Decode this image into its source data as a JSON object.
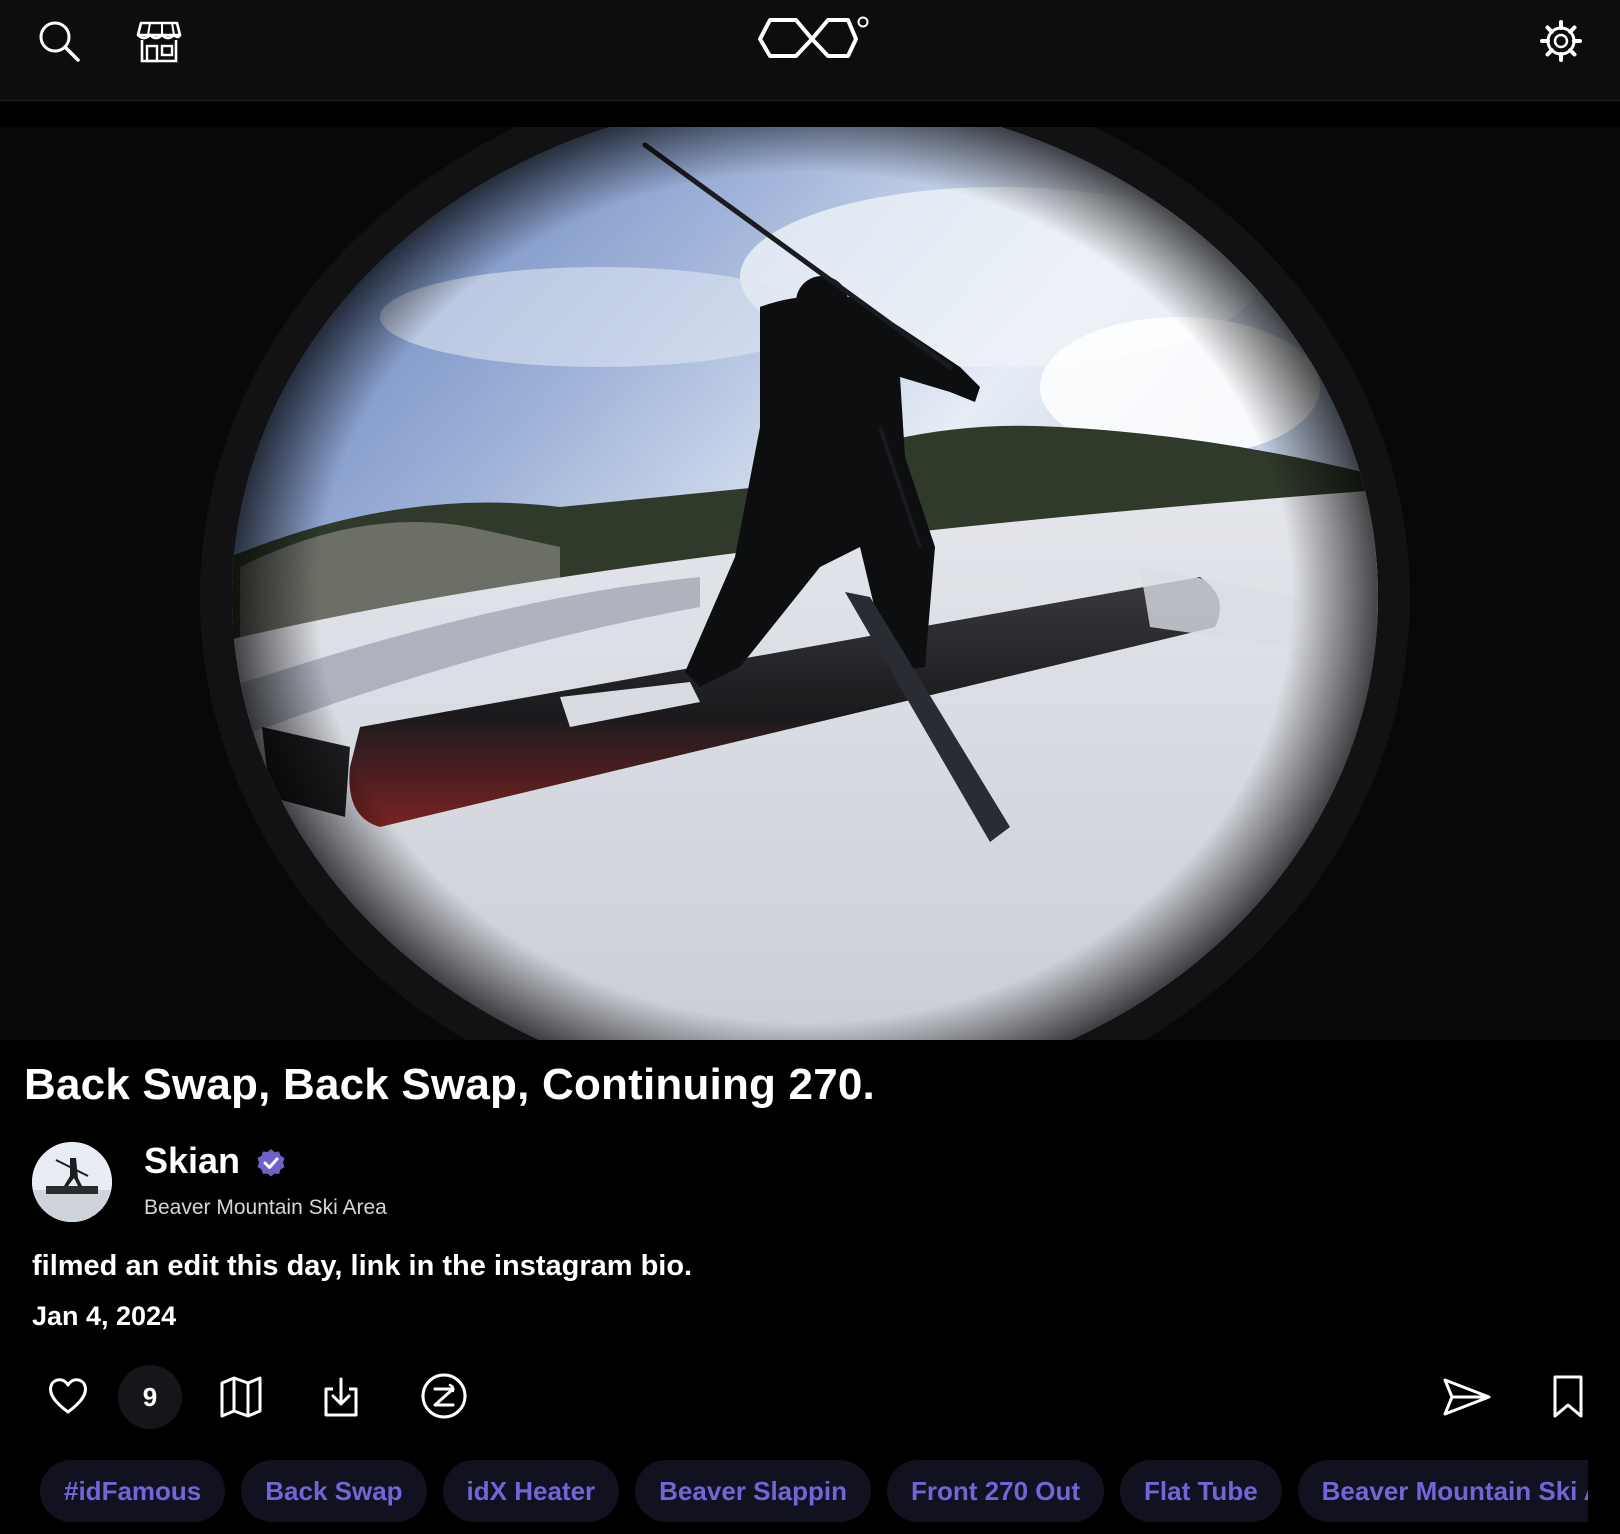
{
  "header": {
    "icons": [
      "search-icon",
      "shop-icon",
      "app-logo",
      "settings-gear-icon"
    ]
  },
  "post": {
    "title": "Back Swap, Back Swap, Continuing 270.",
    "media_alt": "Fisheye photo of a skier doing a swap on a flat tube rail at a ski area",
    "author": {
      "name": "Skian",
      "verified": true,
      "location": "Beaver Mountain Ski Area"
    },
    "caption": "filmed an edit this day, link in the instagram bio.",
    "date": "Jan 4, 2024",
    "likes_count": "9"
  },
  "actions": {
    "icons": [
      "heart-icon",
      "map-icon",
      "download-icon",
      "tip-icon",
      "share-icon",
      "bookmark-icon"
    ]
  },
  "tags": [
    "#idFamous",
    "Back Swap",
    "idX Heater",
    "Beaver Slappin",
    "Front 270 Out",
    "Flat Tube",
    "Beaver Mountain Ski Area"
  ],
  "colors": {
    "background": "#000000",
    "topbar": "#0d0d0f",
    "tag_text": "#6f67d8",
    "tag_bg": "#111120",
    "verified_badge": "#6b63c9"
  }
}
